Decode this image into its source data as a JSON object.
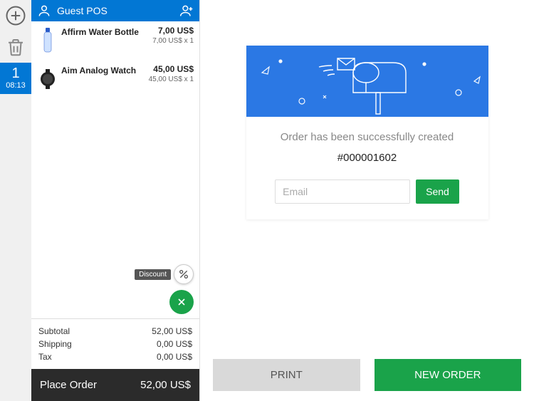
{
  "header": {
    "title": "Guest POS"
  },
  "sidebar": {
    "tab_number": "1",
    "tab_time": "08:13"
  },
  "cart": {
    "items": [
      {
        "name": "Affirm Water Bottle",
        "price": "7,00 US$",
        "sub": "7,00 US$ x 1"
      },
      {
        "name": "Aim Analog Watch",
        "price": "45,00 US$",
        "sub": "45,00 US$ x 1"
      }
    ],
    "discount_label": "Discount",
    "totals": {
      "subtotal_label": "Subtotal",
      "subtotal_value": "52,00 US$",
      "shipping_label": "Shipping",
      "shipping_value": "0,00 US$",
      "tax_label": "Tax",
      "tax_value": "0,00 US$"
    },
    "place_order_label": "Place Order",
    "place_order_total": "52,00 US$"
  },
  "confirm": {
    "message": "Order has been successfully created",
    "order_id": "#000001602",
    "email_placeholder": "Email",
    "send_label": "Send"
  },
  "actions": {
    "print": "PRINT",
    "new_order": "NEW ORDER"
  }
}
